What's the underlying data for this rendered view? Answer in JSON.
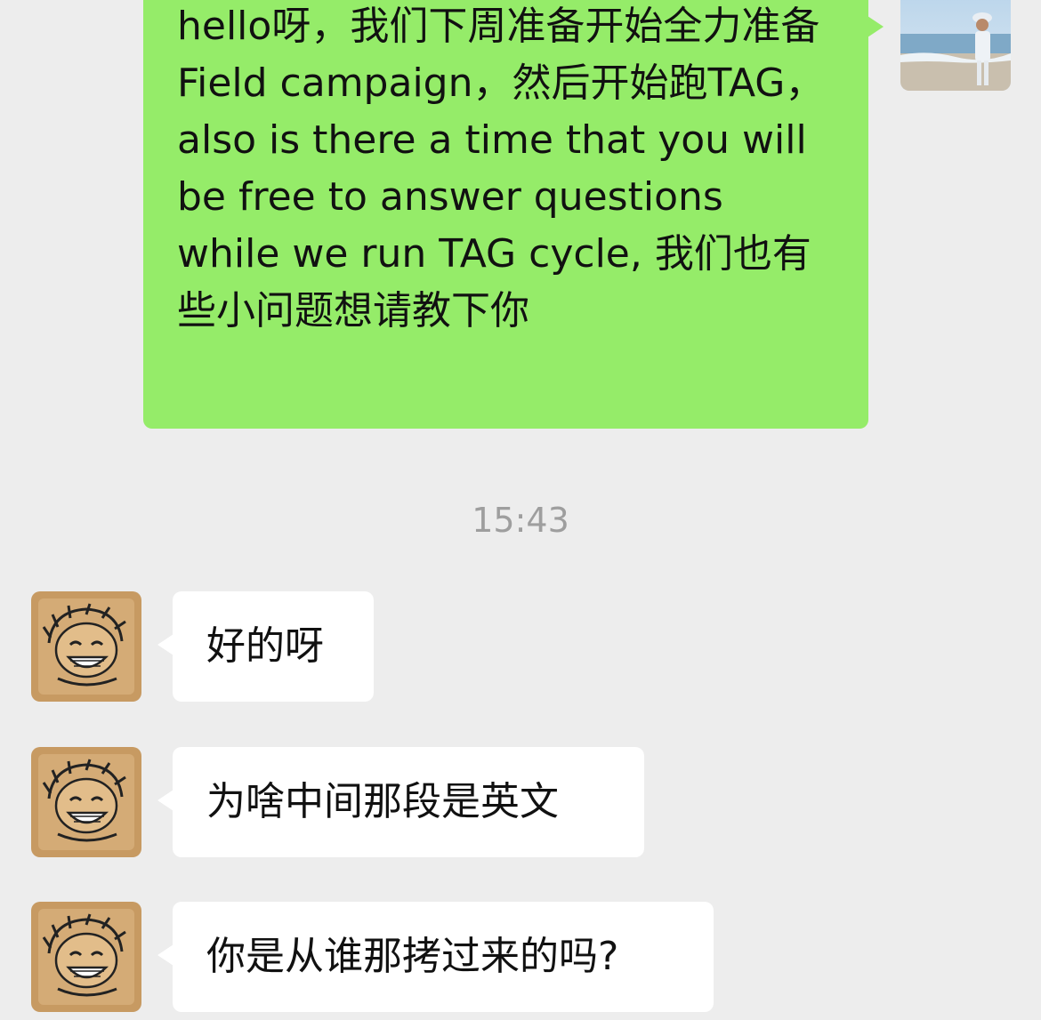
{
  "messages": [
    {
      "sender": "me",
      "text": "hello呀，我们下周准备开始全力准备Field campaign，然后开始跑TAG，also is there a time that you will be free to answer questions while we run TAG cycle, 我们也有些小问题想请教下你"
    },
    {
      "sender": "other",
      "text": "好的呀"
    },
    {
      "sender": "other",
      "text": "为啥中间那段是英文"
    },
    {
      "sender": "other",
      "text": "你是从谁那拷过来的吗?"
    }
  ],
  "timestamp": "15:43",
  "colors": {
    "background": "#ededed",
    "outgoing_bubble": "#95ec69",
    "incoming_bubble": "#ffffff",
    "timestamp_text": "#9e9e9e"
  },
  "avatars": {
    "me": "beach-photo-avatar",
    "other": "cartoon-face-avatar"
  }
}
